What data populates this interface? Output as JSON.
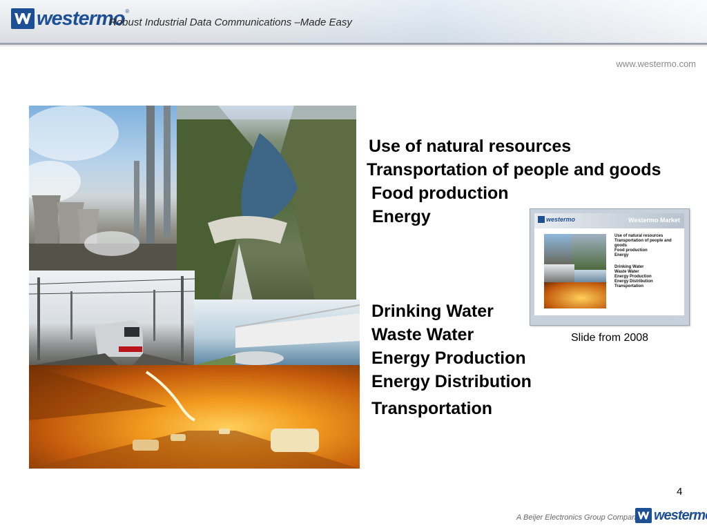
{
  "header": {
    "brand": "westermo",
    "tagline": "Robust Industrial Data Communications –Made Easy"
  },
  "website": "www.westermo.com",
  "bullets_top": [
    "Use of natural resources",
    "Transportation of people and goods",
    "Food production",
    "Energy"
  ],
  "bullets_bottom": [
    "Drinking Water",
    "Waste Water",
    "Energy Production",
    "Energy Distribution",
    "Transportation"
  ],
  "thumbnail": {
    "brand": "westermo",
    "title": "Westermo Market",
    "items_top": [
      "Use of natural resources",
      "Transportation of people and goods",
      "Food production",
      "Energy"
    ],
    "items_bottom": [
      "Drinking Water",
      "Waste Water",
      "Energy Production",
      "Energy Distribution",
      "Transportation"
    ]
  },
  "caption": "Slide from 2008",
  "page_number": "4",
  "footer": {
    "group_text": "A Beijer Electronics Group Company",
    "brand": "westermo"
  },
  "colors": {
    "brand_blue": "#1d4f95",
    "text": "#000000"
  }
}
